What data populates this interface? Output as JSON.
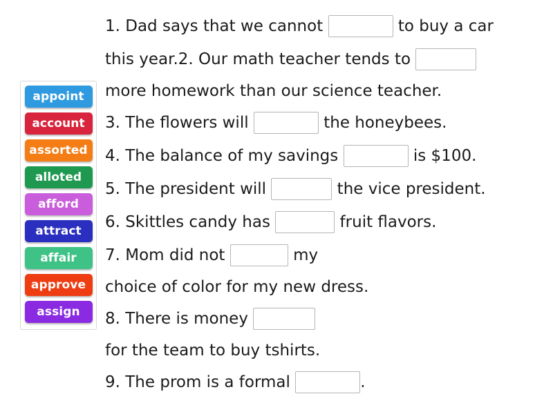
{
  "word_bank": {
    "name": "word-bank",
    "tiles": [
      {
        "label": "appoint",
        "color": "#2f9ae0"
      },
      {
        "label": "account",
        "color": "#d8243c"
      },
      {
        "label": "assorted",
        "color": "#f47d16"
      },
      {
        "label": "alloted",
        "color": "#1f9950"
      },
      {
        "label": "afford",
        "color": "#c95ddb"
      },
      {
        "label": "attract",
        "color": "#2a2fc0"
      },
      {
        "label": "affair",
        "color": "#3fc285"
      },
      {
        "label": "approve",
        "color": "#ee3d12"
      },
      {
        "label": "assign",
        "color": "#8a2be2"
      }
    ]
  },
  "exercise": {
    "lines": [
      {
        "before": "1. Dad says that we cannot ",
        "blank": true,
        "after": " to buy a car"
      },
      {
        "before": "this year.2. Our math teacher tends to ",
        "blank": true,
        "after": ""
      },
      {
        "before": "more homework than our science teacher.",
        "blank": false,
        "after": ""
      },
      {
        "before": "3. The flowers will ",
        "blank": true,
        "after": " the honeybees."
      },
      {
        "before": "4. The balance of my savings ",
        "blank": true,
        "after": " is $100."
      },
      {
        "before": "5. The president will ",
        "blank": true,
        "after": " the vice president."
      },
      {
        "before": "6. Skittles candy has ",
        "blank": true,
        "after": " fruit flavors."
      },
      {
        "before": "7. Mom did not ",
        "blank": true,
        "after": " my"
      },
      {
        "before": "choice of color for my new dress.",
        "blank": false,
        "after": ""
      },
      {
        "before": "8. There is money ",
        "blank": true,
        "after": ""
      },
      {
        "before": "for the team to buy tshirts.",
        "blank": false,
        "after": ""
      },
      {
        "before": "9. The prom is a formal ",
        "blank": true,
        "after": "."
      }
    ]
  }
}
